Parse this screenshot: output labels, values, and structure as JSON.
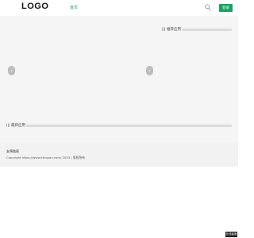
{
  "header": {
    "logo": "LOGO",
    "nav_home": "首页",
    "search_icon": "search-icon",
    "login_label": "登录",
    "accent_color": "#19a15f"
  },
  "main": {
    "section1_title": "||| 推荐应用",
    "prev_icon": "chevron-left-icon",
    "next_icon": "chevron-right-icon",
    "prev_symbol": "‹",
    "next_symbol": "›",
    "section2_title": "||| 最新应用"
  },
  "footer": {
    "link": "友情链接",
    "copyright": "Copyright https://www.khiquan.com/ 2023 | 版权所有"
  },
  "floating_tag": "在线客服"
}
